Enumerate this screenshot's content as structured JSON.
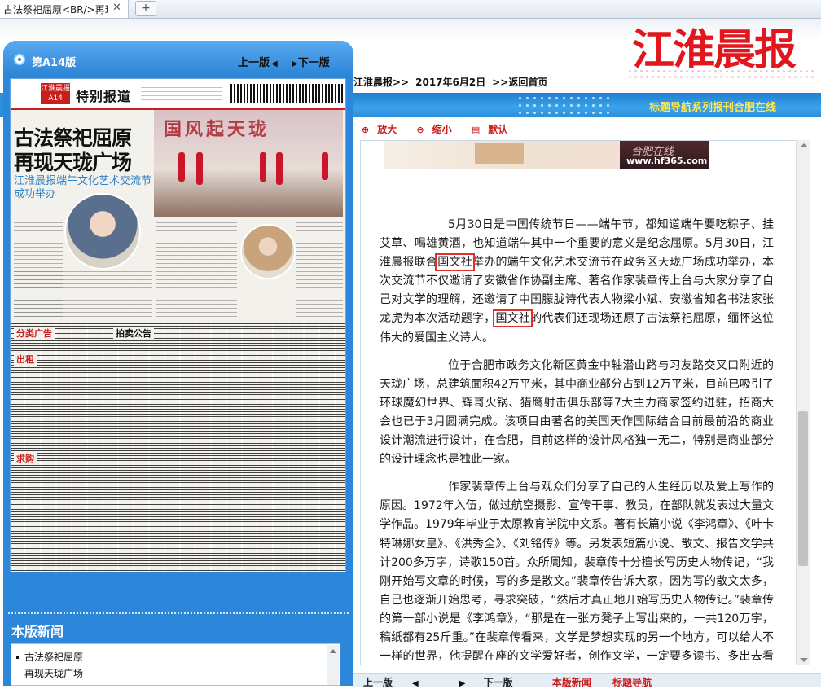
{
  "browser": {
    "tab_title": "古法祭祀屈原<BR/>再现",
    "new_tab": "+",
    "close": "✕"
  },
  "brand": {
    "logo_text": "江淮晨报",
    "color": "#e2161d"
  },
  "breadcrumb": {
    "paper": "江淮晨报>>",
    "date": "2017年6月2日",
    "home": ">>返回首页"
  },
  "band_links": "标题导航系列报刊合肥在线",
  "left_panel": {
    "edition": "第A14版",
    "prev": "上一版",
    "next": "下一版",
    "news_heading": "本版新闻",
    "news_items": [
      "古法祭祀屈原",
      "再现天珑广场"
    ]
  },
  "paper_page": {
    "tag": "江淮晨报 A14",
    "section": "特别报道",
    "headline_1": "古法祭祀屈原",
    "headline_2": "再现天珑广场",
    "subhead": "江淮晨报端午文化艺术交流节成功举办",
    "photo_title": "国风起天珑",
    "ads_1": "分类广告",
    "ads_2": "拍卖公告",
    "ads_3": "出租",
    "ads_4": "求购"
  },
  "zoom": {
    "zoom_in": "放大",
    "zoom_out": "缩小",
    "default": "默认"
  },
  "ad_strip": {
    "url": "www.hf365.com",
    "mark": "合肥在线"
  },
  "article": {
    "p1_a": "5月30日是中国传统节日——端午节，都知道端午要吃粽子、挂艾草、喝雄黄酒，也知道端午其中一个重要的意义是纪念屈原。5月30日，江淮晨报联合",
    "p1_hl1": "国文社",
    "p1_b": "举办的端午文化艺术交流节在政务区天珑广场成功举办，本次交流节不仅邀请了安徽省作协副主席、著名作家裴章传上台与大家分享了自己对文学的理解，还邀请了中国朦胧诗代表人物梁小斌、安徽省知名书法家张龙虎为本次活动题字，",
    "p1_hl2": "国文社",
    "p1_c": "的代表们还现场还原了古法祭祀屈原，缅怀这位伟大的爱国主义诗人。",
    "p2": "位于合肥市政务文化新区黄金中轴潜山路与习友路交叉口附近的天珑广场，总建筑面积42万平米，其中商业部分占到12万平米，目前已吸引了环球魔幻世界、辉哥火锅、猎鹰射击俱乐部等7大主力商家签约进驻，招商大会也已于3月圆满完成。该项目由著名的美国天作国际结合目前最前沿的商业设计潮流进行设计，在合肥，目前这样的设计风格独一无二，特别是商业部分的设计理念也是独此一家。",
    "p3": "作家裴章传上台与观众们分享了自己的人生经历以及爱上写作的原因。1972年入伍，做过航空摄影、宣传干事、教员，在部队就发表过大量文学作品。1979年毕业于太原教育学院中文系。著有长篇小说《李鸿章》、《叶卡特琳娜女皇》、《洪秀全》、《刘铭传》等。另发表短篇小说、散文、报告文学共计200多万字，诗歌150首。众所周知，裴章传十分擅长写历史人物传记，“我刚开始写文章的时候，写的多是散文。”裴章传告诉大家，因为写的散文太多，自己也逐渐开始思考，寻求突破，“然后才真正地开始写历史人物传记。”裴章传的第一部小说是《李鸿章》，“那是在一张方凳子上写出来的，一共120万字，稿纸都有25斤重。”在裴章传看来，文学是梦想实现的另一个地方，可以给人不一样的世界，他提醒在座的文学爱好者，创作文学，一定要多读书、多出去看看、多思考。"
  },
  "bottom_nav": {
    "prev": "上一版",
    "next": "下一版",
    "news": "本版新闻",
    "titles": "标题导航"
  }
}
